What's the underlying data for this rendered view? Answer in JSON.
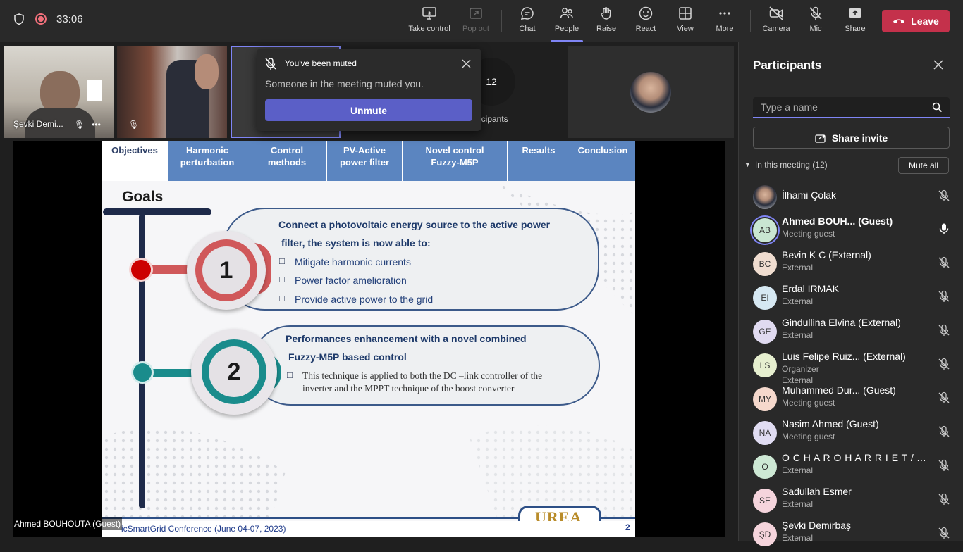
{
  "topbar": {
    "timer": "33:06",
    "buttons": [
      {
        "label": "Take control",
        "icon": "take-control-icon"
      },
      {
        "label": "Pop out",
        "icon": "pop-out-icon"
      },
      {
        "label": "Chat",
        "icon": "chat-icon"
      },
      {
        "label": "People",
        "icon": "people-icon"
      },
      {
        "label": "Raise",
        "icon": "raise-hand-icon"
      },
      {
        "label": "React",
        "icon": "react-icon"
      },
      {
        "label": "View",
        "icon": "view-icon"
      },
      {
        "label": "More",
        "icon": "more-icon"
      },
      {
        "label": "Camera",
        "icon": "camera-off-icon"
      },
      {
        "label": "Mic",
        "icon": "mic-off-icon"
      },
      {
        "label": "Share",
        "icon": "share-icon"
      }
    ],
    "leave_label": "Leave",
    "leave_color": "#c4314b"
  },
  "tiles": {
    "first_name": "Şevki Demi...",
    "count": "12",
    "count_label": "icipants"
  },
  "muted_popup": {
    "title": "You've been muted",
    "body": "Someone in the meeting muted you.",
    "button": "Unmute"
  },
  "slide": {
    "tabs": [
      {
        "line1": "Objectives",
        "line2": ""
      },
      {
        "line1": "Harmonic",
        "line2": "perturbation"
      },
      {
        "line1": "Control",
        "line2": "methods"
      },
      {
        "line1": "PV-Active",
        "line2": "power filter"
      },
      {
        "line1": "Novel control",
        "line2": "Fuzzy-M5P"
      },
      {
        "line1": "Results",
        "line2": ""
      },
      {
        "line1": "Conclusion",
        "line2": ""
      }
    ],
    "heading": "Goals",
    "goal1": {
      "number": "1",
      "line1": "Connect a photovoltaic energy source to the active power",
      "line2": "filter, the system is now able to:",
      "items": [
        "Mitigate harmonic currents",
        "Power factor amelioration",
        "Provide active power to the grid"
      ]
    },
    "goal2": {
      "number": "2",
      "line1": "Performances enhancement with a novel combined",
      "line2": "Fuzzy-M5P based control",
      "item_line1": "This technique is applied to both the DC –link controller of the",
      "item_line2": "inverter and the MPPT technique of the boost converter"
    },
    "footer": "icSmartGrid Conference (June 04-07, 2023)",
    "page": "2",
    "logo_text": "UREA"
  },
  "presenter_name": "Ahmed BOUHOUTA (Guest)",
  "panel": {
    "title": "Participants",
    "search_placeholder": "Type a name",
    "share_invite": "Share invite",
    "in_meeting": "In this meeting (12)",
    "mute_all": "Mute all",
    "participants": [
      {
        "initials": "",
        "name": "İlhami Çolak",
        "role": "",
        "avatar_color": "#c9c9c9",
        "mic": "off"
      },
      {
        "initials": "AB",
        "name": "Ahmed BOUH...    (Guest)",
        "role": "Meeting guest",
        "avatar_color": "#c9e6d2",
        "mic": "on"
      },
      {
        "initials": "BC",
        "name": "Bevin K C (External)",
        "role": "External",
        "avatar_color": "#f0ddd0",
        "mic": "off"
      },
      {
        "initials": "EI",
        "name": "Erdal IRMAK",
        "role": "External",
        "avatar_color": "#d6e8f2",
        "mic": "off"
      },
      {
        "initials": "GE",
        "name": "Gindullina Elvina (External)",
        "role": "External",
        "avatar_color": "#e0daf0",
        "mic": "off"
      },
      {
        "initials": "LS",
        "name": "Luis Felipe Ruiz...  (External)",
        "role": "Organizer",
        "role2": "External",
        "avatar_color": "#e6efcf",
        "mic": "off"
      },
      {
        "initials": "MY",
        "name": "Muhammed Dur... (Guest)",
        "role": "Meeting guest",
        "avatar_color": "#f5d8cc",
        "mic": "off"
      },
      {
        "initials": "NA",
        "name": "Nasim Ahmed (Guest)",
        "role": "Meeting guest",
        "avatar_color": "#e0dcf2",
        "mic": "off"
      },
      {
        "initials": "O",
        "name": "O C H A R O H A R R I E T / ...",
        "role": "External",
        "avatar_color": "#cde8d4",
        "mic": "off"
      },
      {
        "initials": "SE",
        "name": "Sadullah Esmer",
        "role": "External",
        "avatar_color": "#f5d4dc",
        "mic": "off"
      },
      {
        "initials": "ŞD",
        "name": "Şevki Demirbaş",
        "role": "External",
        "avatar_color": "#f5d4dc",
        "mic": "off"
      }
    ]
  }
}
